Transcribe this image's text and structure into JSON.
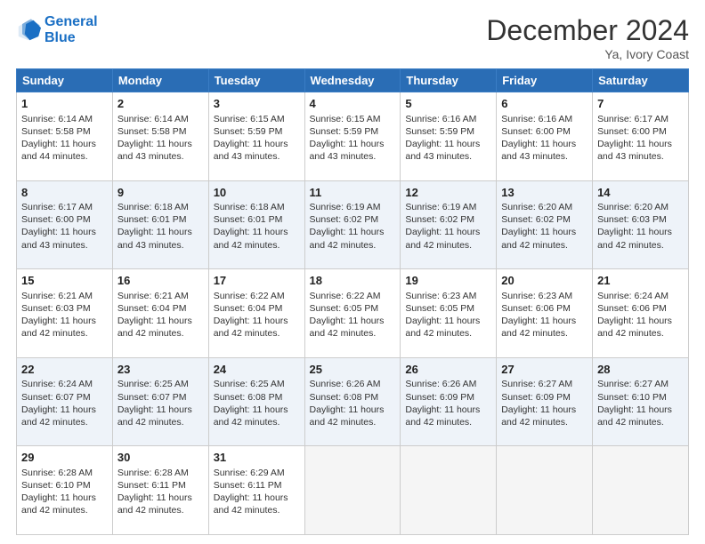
{
  "logo": {
    "line1": "General",
    "line2": "Blue"
  },
  "title": "December 2024",
  "location": "Ya, Ivory Coast",
  "days_header": [
    "Sunday",
    "Monday",
    "Tuesday",
    "Wednesday",
    "Thursday",
    "Friday",
    "Saturday"
  ],
  "weeks": [
    [
      {
        "day": 1,
        "lines": [
          "Sunrise: 6:14 AM",
          "Sunset: 5:58 PM",
          "Daylight: 11 hours",
          "and 44 minutes."
        ]
      },
      {
        "day": 2,
        "lines": [
          "Sunrise: 6:14 AM",
          "Sunset: 5:58 PM",
          "Daylight: 11 hours",
          "and 43 minutes."
        ]
      },
      {
        "day": 3,
        "lines": [
          "Sunrise: 6:15 AM",
          "Sunset: 5:59 PM",
          "Daylight: 11 hours",
          "and 43 minutes."
        ]
      },
      {
        "day": 4,
        "lines": [
          "Sunrise: 6:15 AM",
          "Sunset: 5:59 PM",
          "Daylight: 11 hours",
          "and 43 minutes."
        ]
      },
      {
        "day": 5,
        "lines": [
          "Sunrise: 6:16 AM",
          "Sunset: 5:59 PM",
          "Daylight: 11 hours",
          "and 43 minutes."
        ]
      },
      {
        "day": 6,
        "lines": [
          "Sunrise: 6:16 AM",
          "Sunset: 6:00 PM",
          "Daylight: 11 hours",
          "and 43 minutes."
        ]
      },
      {
        "day": 7,
        "lines": [
          "Sunrise: 6:17 AM",
          "Sunset: 6:00 PM",
          "Daylight: 11 hours",
          "and 43 minutes."
        ]
      }
    ],
    [
      {
        "day": 8,
        "lines": [
          "Sunrise: 6:17 AM",
          "Sunset: 6:00 PM",
          "Daylight: 11 hours",
          "and 43 minutes."
        ]
      },
      {
        "day": 9,
        "lines": [
          "Sunrise: 6:18 AM",
          "Sunset: 6:01 PM",
          "Daylight: 11 hours",
          "and 43 minutes."
        ]
      },
      {
        "day": 10,
        "lines": [
          "Sunrise: 6:18 AM",
          "Sunset: 6:01 PM",
          "Daylight: 11 hours",
          "and 42 minutes."
        ]
      },
      {
        "day": 11,
        "lines": [
          "Sunrise: 6:19 AM",
          "Sunset: 6:02 PM",
          "Daylight: 11 hours",
          "and 42 minutes."
        ]
      },
      {
        "day": 12,
        "lines": [
          "Sunrise: 6:19 AM",
          "Sunset: 6:02 PM",
          "Daylight: 11 hours",
          "and 42 minutes."
        ]
      },
      {
        "day": 13,
        "lines": [
          "Sunrise: 6:20 AM",
          "Sunset: 6:02 PM",
          "Daylight: 11 hours",
          "and 42 minutes."
        ]
      },
      {
        "day": 14,
        "lines": [
          "Sunrise: 6:20 AM",
          "Sunset: 6:03 PM",
          "Daylight: 11 hours",
          "and 42 minutes."
        ]
      }
    ],
    [
      {
        "day": 15,
        "lines": [
          "Sunrise: 6:21 AM",
          "Sunset: 6:03 PM",
          "Daylight: 11 hours",
          "and 42 minutes."
        ]
      },
      {
        "day": 16,
        "lines": [
          "Sunrise: 6:21 AM",
          "Sunset: 6:04 PM",
          "Daylight: 11 hours",
          "and 42 minutes."
        ]
      },
      {
        "day": 17,
        "lines": [
          "Sunrise: 6:22 AM",
          "Sunset: 6:04 PM",
          "Daylight: 11 hours",
          "and 42 minutes."
        ]
      },
      {
        "day": 18,
        "lines": [
          "Sunrise: 6:22 AM",
          "Sunset: 6:05 PM",
          "Daylight: 11 hours",
          "and 42 minutes."
        ]
      },
      {
        "day": 19,
        "lines": [
          "Sunrise: 6:23 AM",
          "Sunset: 6:05 PM",
          "Daylight: 11 hours",
          "and 42 minutes."
        ]
      },
      {
        "day": 20,
        "lines": [
          "Sunrise: 6:23 AM",
          "Sunset: 6:06 PM",
          "Daylight: 11 hours",
          "and 42 minutes."
        ]
      },
      {
        "day": 21,
        "lines": [
          "Sunrise: 6:24 AM",
          "Sunset: 6:06 PM",
          "Daylight: 11 hours",
          "and 42 minutes."
        ]
      }
    ],
    [
      {
        "day": 22,
        "lines": [
          "Sunrise: 6:24 AM",
          "Sunset: 6:07 PM",
          "Daylight: 11 hours",
          "and 42 minutes."
        ]
      },
      {
        "day": 23,
        "lines": [
          "Sunrise: 6:25 AM",
          "Sunset: 6:07 PM",
          "Daylight: 11 hours",
          "and 42 minutes."
        ]
      },
      {
        "day": 24,
        "lines": [
          "Sunrise: 6:25 AM",
          "Sunset: 6:08 PM",
          "Daylight: 11 hours",
          "and 42 minutes."
        ]
      },
      {
        "day": 25,
        "lines": [
          "Sunrise: 6:26 AM",
          "Sunset: 6:08 PM",
          "Daylight: 11 hours",
          "and 42 minutes."
        ]
      },
      {
        "day": 26,
        "lines": [
          "Sunrise: 6:26 AM",
          "Sunset: 6:09 PM",
          "Daylight: 11 hours",
          "and 42 minutes."
        ]
      },
      {
        "day": 27,
        "lines": [
          "Sunrise: 6:27 AM",
          "Sunset: 6:09 PM",
          "Daylight: 11 hours",
          "and 42 minutes."
        ]
      },
      {
        "day": 28,
        "lines": [
          "Sunrise: 6:27 AM",
          "Sunset: 6:10 PM",
          "Daylight: 11 hours",
          "and 42 minutes."
        ]
      }
    ],
    [
      {
        "day": 29,
        "lines": [
          "Sunrise: 6:28 AM",
          "Sunset: 6:10 PM",
          "Daylight: 11 hours",
          "and 42 minutes."
        ]
      },
      {
        "day": 30,
        "lines": [
          "Sunrise: 6:28 AM",
          "Sunset: 6:11 PM",
          "Daylight: 11 hours",
          "and 42 minutes."
        ]
      },
      {
        "day": 31,
        "lines": [
          "Sunrise: 6:29 AM",
          "Sunset: 6:11 PM",
          "Daylight: 11 hours",
          "and 42 minutes."
        ]
      },
      null,
      null,
      null,
      null
    ]
  ]
}
